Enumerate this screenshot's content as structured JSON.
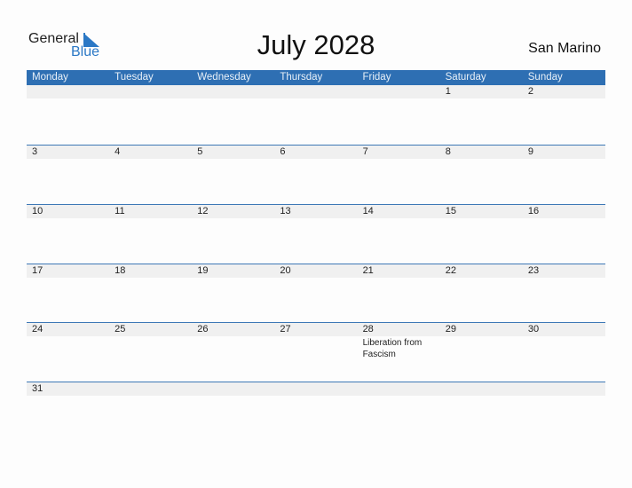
{
  "logo": {
    "general": "General",
    "blue": "Blue",
    "icon": "triangle-logo-icon"
  },
  "title": "July 2028",
  "country": "San Marino",
  "weekdays": [
    "Monday",
    "Tuesday",
    "Wednesday",
    "Thursday",
    "Friday",
    "Saturday",
    "Sunday"
  ],
  "weeks": [
    [
      {
        "day": ""
      },
      {
        "day": ""
      },
      {
        "day": ""
      },
      {
        "day": ""
      },
      {
        "day": ""
      },
      {
        "day": "1"
      },
      {
        "day": "2"
      }
    ],
    [
      {
        "day": "3"
      },
      {
        "day": "4"
      },
      {
        "day": "5"
      },
      {
        "day": "6"
      },
      {
        "day": "7"
      },
      {
        "day": "8"
      },
      {
        "day": "9"
      }
    ],
    [
      {
        "day": "10"
      },
      {
        "day": "11"
      },
      {
        "day": "12"
      },
      {
        "day": "13"
      },
      {
        "day": "14"
      },
      {
        "day": "15"
      },
      {
        "day": "16"
      }
    ],
    [
      {
        "day": "17"
      },
      {
        "day": "18"
      },
      {
        "day": "19"
      },
      {
        "day": "20"
      },
      {
        "day": "21"
      },
      {
        "day": "22"
      },
      {
        "day": "23"
      }
    ],
    [
      {
        "day": "24"
      },
      {
        "day": "25"
      },
      {
        "day": "26"
      },
      {
        "day": "27"
      },
      {
        "day": "28",
        "holiday": "Liberation from Fascism"
      },
      {
        "day": "29"
      },
      {
        "day": "30"
      }
    ],
    [
      {
        "day": "31"
      },
      {
        "day": ""
      },
      {
        "day": ""
      },
      {
        "day": ""
      },
      {
        "day": ""
      },
      {
        "day": ""
      },
      {
        "day": ""
      }
    ]
  ],
  "colors": {
    "header_bg": "#2e6fb3",
    "accent": "#2b78c5",
    "date_bar": "#f0f0f0"
  }
}
